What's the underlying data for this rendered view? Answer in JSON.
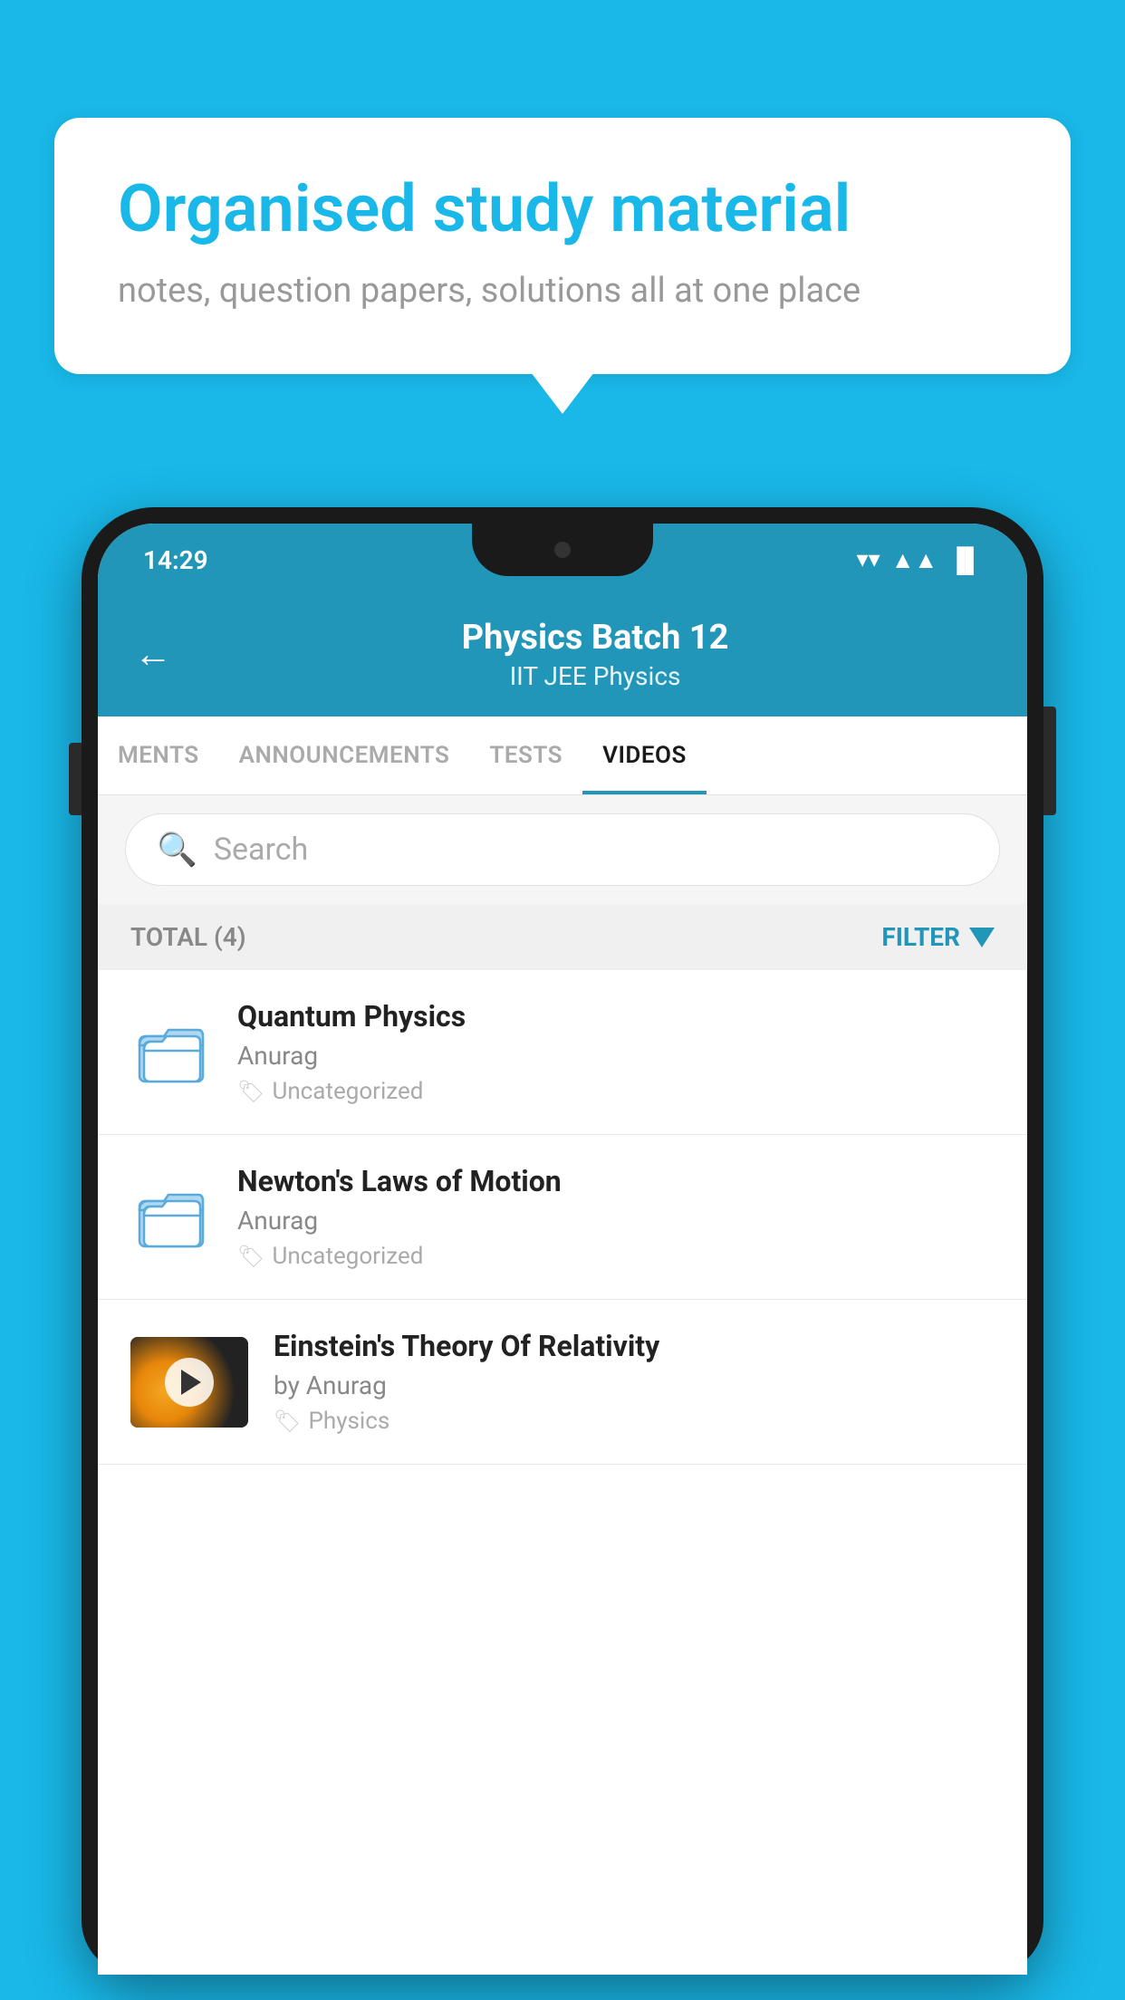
{
  "promo": {
    "title": "Organised study material",
    "subtitle": "notes, question papers, solutions all at one place"
  },
  "status_bar": {
    "time": "14:29",
    "wifi": "▼",
    "signal": "▲",
    "battery": "▐"
  },
  "header": {
    "title": "Physics Batch 12",
    "subtitle": "IIT JEE   Physics",
    "back_label": "←"
  },
  "tabs": [
    {
      "label": "MENTS",
      "active": false
    },
    {
      "label": "ANNOUNCEMENTS",
      "active": false
    },
    {
      "label": "TESTS",
      "active": false
    },
    {
      "label": "VIDEOS",
      "active": true
    }
  ],
  "search": {
    "placeholder": "Search"
  },
  "filter_bar": {
    "total": "TOTAL (4)",
    "filter_label": "FILTER"
  },
  "videos": [
    {
      "id": 1,
      "title": "Quantum Physics",
      "author": "Anurag",
      "tag": "Uncategorized",
      "type": "folder",
      "thumbnail": null
    },
    {
      "id": 2,
      "title": "Newton's Laws of Motion",
      "author": "Anurag",
      "tag": "Uncategorized",
      "type": "folder",
      "thumbnail": null
    },
    {
      "id": 3,
      "title": "Einstein's Theory Of Relativity",
      "author": "by Anurag",
      "tag": "Physics",
      "type": "video",
      "thumbnail": "space"
    }
  ]
}
